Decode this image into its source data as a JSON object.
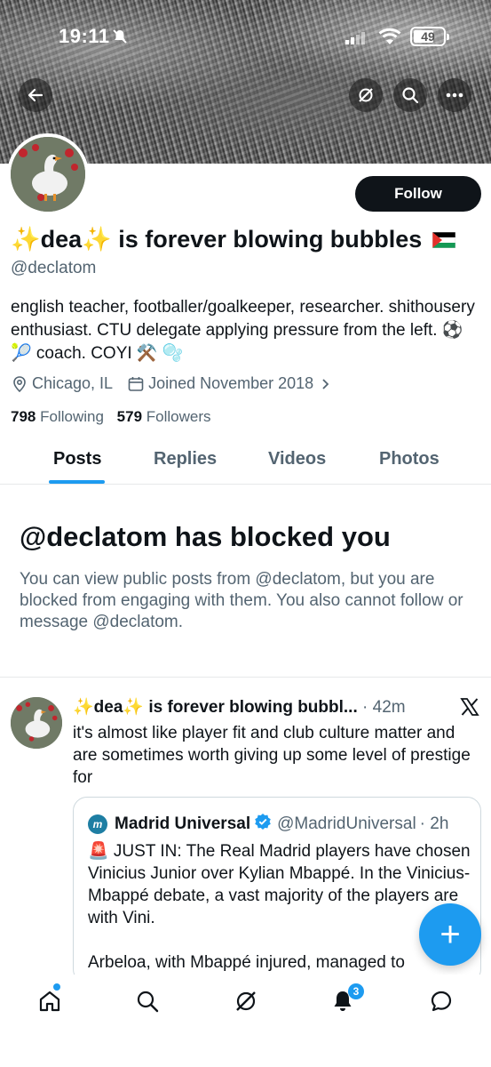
{
  "status_bar": {
    "time": "19:11",
    "battery": "49"
  },
  "profile": {
    "display_name": "✨dea✨ is forever blowing bubbles",
    "handle": "@declatom",
    "bio": "english teacher, footballer/goalkeeper, researcher. shithousery enthusiast. CTU delegate applying pressure from the left. ⚽ 🎾 coach. COYI ⚒️ 🫧",
    "location": "Chicago, IL",
    "joined": "Joined November 2018",
    "following_count": "798",
    "following_label": "Following",
    "followers_count": "579",
    "followers_label": "Followers",
    "follow_button": "Follow"
  },
  "tabs": [
    {
      "label": "Posts",
      "active": true
    },
    {
      "label": "Replies",
      "active": false
    },
    {
      "label": "Videos",
      "active": false
    },
    {
      "label": "Photos",
      "active": false
    }
  ],
  "blocked": {
    "title": "@declatom has blocked you",
    "description": "You can view public posts from @declatom, but you are blocked from engaging with them. You also cannot follow or message @declatom."
  },
  "post": {
    "author": "✨dea✨ is forever blowing bubbl...",
    "time": "· 42m",
    "text": "it's almost like player fit and club culture matter and are sometimes worth giving up some level of prestige for",
    "quote": {
      "avatar_letter": "m",
      "name": "Madrid Universal",
      "handle": "@MadridUniversal",
      "time": "· 2h",
      "text1": "🚨 JUST IN: The Real Madrid players have chosen Vinicius Junior over Kylian Mbappé. In the Vinicius-Mbappé debate, a vast majority of the players are with Vini.",
      "text2": "Arbeloa, with Mbappé injured, managed to"
    }
  },
  "fab_label": "+",
  "notifications_badge": "3",
  "colors": {
    "accent": "#1d9bf0",
    "text": "#0f1419",
    "secondary": "#536471",
    "border": "#e7e9ea"
  }
}
